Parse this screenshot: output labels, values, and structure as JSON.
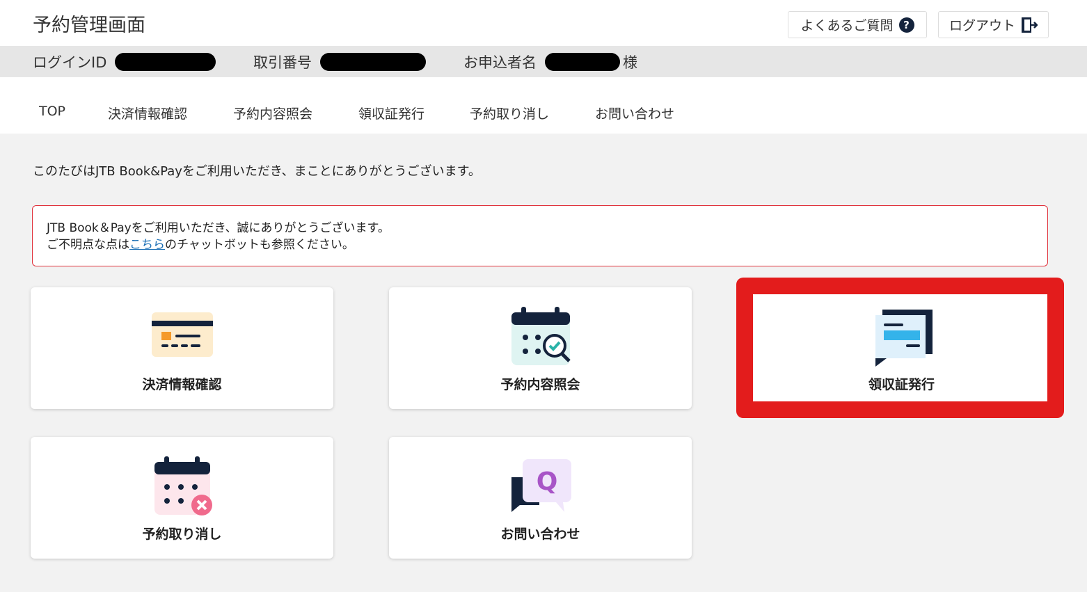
{
  "header": {
    "title": "予約管理画面",
    "faq_label": "よくあるご質問",
    "faq_icon_glyph": "?",
    "logout_label": "ログアウト"
  },
  "infobar": {
    "login_id_label": "ログインID",
    "deal_number_label": "取引番号",
    "applicant_label": "お申込者名",
    "honorific": "様"
  },
  "nav": {
    "items": [
      "TOP",
      "決済情報確認",
      "予約内容照会",
      "領収証発行",
      "予約取り消し",
      "お問い合わせ"
    ]
  },
  "welcome_text": "このたびはJTB Book&Payをご利用いただき、まことにありがとうございます。",
  "notice": {
    "line1": "JTB Book＆Payをご利用いただき、誠にありがとうございます。",
    "line2_prefix": "ご不明点な点は",
    "line2_link": "こちら",
    "line2_suffix": "のチャットボットも参照ください。"
  },
  "cards": [
    {
      "label": "決済情報確認",
      "icon": "credit-card-icon"
    },
    {
      "label": "予約内容照会",
      "icon": "calendar-search-icon"
    },
    {
      "label": "領収証発行",
      "icon": "receipt-icon"
    },
    {
      "label": "予約取り消し",
      "icon": "calendar-cancel-icon"
    },
    {
      "label": "お問い合わせ",
      "icon": "chat-question-icon"
    }
  ],
  "colors": {
    "accent_red": "#e31c1c",
    "navy": "#14233c"
  }
}
